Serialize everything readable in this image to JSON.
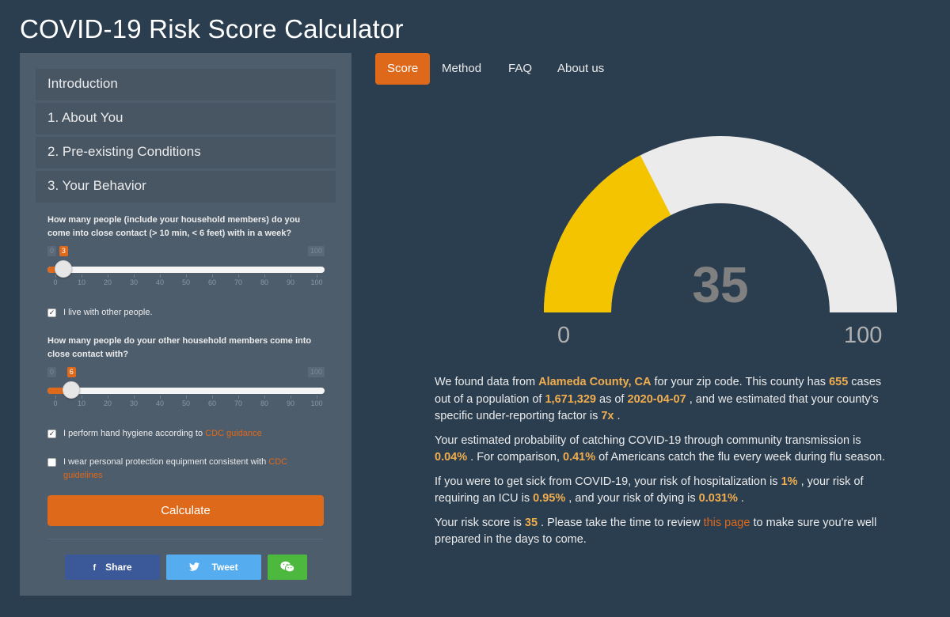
{
  "title": "COVID-19 Risk Score Calculator",
  "sidebar": {
    "sections": [
      "Introduction",
      "1. About You",
      "2. Pre-existing Conditions",
      "3. Your Behavior"
    ],
    "q1": {
      "text": "How many people (include your household members) do you come into close contact (> 10 min, < 6 feet) with in a week?",
      "value": 3,
      "min": 0,
      "max": 100,
      "min_label": "0",
      "max_label": "100",
      "value_label": "3",
      "ticks": [
        "0",
        "10",
        "20",
        "30",
        "40",
        "50",
        "60",
        "70",
        "80",
        "90",
        "100"
      ]
    },
    "live_with_others": {
      "label": "I live with other people.",
      "checked": true
    },
    "q2": {
      "text": "How many people do your other household members come into close contact with?",
      "value": 6,
      "min": 0,
      "max": 100,
      "min_label": "0",
      "max_label": "100",
      "value_label": "6",
      "ticks": [
        "0",
        "10",
        "20",
        "30",
        "40",
        "50",
        "60",
        "70",
        "80",
        "90",
        "100"
      ]
    },
    "hygiene": {
      "label": "I perform hand hygiene according to ",
      "link": "CDC guidance",
      "checked": true
    },
    "ppe": {
      "label": "I wear personal protection equipment consistent with ",
      "link": "CDC guidelines",
      "checked": false
    },
    "calculate_label": "Calculate",
    "share": {
      "facebook": "Share",
      "twitter": "Tweet"
    }
  },
  "tabs": [
    "Score",
    "Method",
    "FAQ",
    "About us"
  ],
  "active_tab": "Score",
  "gauge": {
    "value": 35,
    "min": 0,
    "max": 100,
    "value_label": "35",
    "min_label": "0",
    "max_label": "100",
    "fill_color": "#f5c400",
    "track_color": "#ebebeb"
  },
  "results": {
    "p1": {
      "a": "We found data from ",
      "county": "Alameda County, CA",
      "b": " for your zip code. This county has ",
      "cases": "655",
      "c": " cases out of a population of ",
      "population": "1,671,329",
      "d": " as of ",
      "date": "2020-04-07",
      "e": " , and we estimated that your county's specific under-reporting factor is ",
      "factor": "7x",
      "f": " ."
    },
    "p2": {
      "a": "Your estimated probability of catching COVID-19 through community transmission is ",
      "prob": "0.04%",
      "b": " . For comparison, ",
      "flu": "0.41%",
      "c": " of Americans catch the flu every week during flu season."
    },
    "p3": {
      "a": "If you were to get sick from COVID-19, your risk of hospitalization is ",
      "hosp": "1%",
      "b": " , your risk of requiring an ICU is ",
      "icu": "0.95%",
      "c": " , and your risk of dying is ",
      "death": "0.031%",
      "d": " ."
    },
    "p4": {
      "a": "Your risk score is ",
      "score": "35",
      "b": " . Please take the time to review ",
      "link": "this page",
      "c": " to make sure you're well prepared in the days to come."
    }
  },
  "colors": {
    "background": "#2b3e50",
    "panel": "#4e5d6c",
    "accent": "#df691a",
    "highlight": "#f0ad4e"
  }
}
